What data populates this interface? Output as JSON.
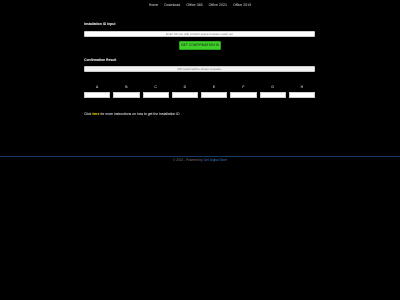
{
  "nav": {
    "items": [
      "Home",
      "Download",
      "Office 365",
      "Office 2021",
      "Office 2019"
    ]
  },
  "installation": {
    "title": "Installation ID Input",
    "placeholder": "Enter 63 nos with a blank space between each set"
  },
  "button": {
    "label": "GET CONFIRMATION ID"
  },
  "confirmation": {
    "title": "Confirmation Result",
    "placeholder": "CID result will be shown remarks."
  },
  "grid": {
    "labels": [
      "A",
      "B",
      "C",
      "D",
      "E",
      "F",
      "G",
      "H"
    ]
  },
  "help": {
    "prefix": "Click",
    "link": "here",
    "suffix": "for more instructions on how to get the Installation ID"
  },
  "footer": {
    "text": "© 2023 - Powered by",
    "link": "Get Digital Store"
  }
}
